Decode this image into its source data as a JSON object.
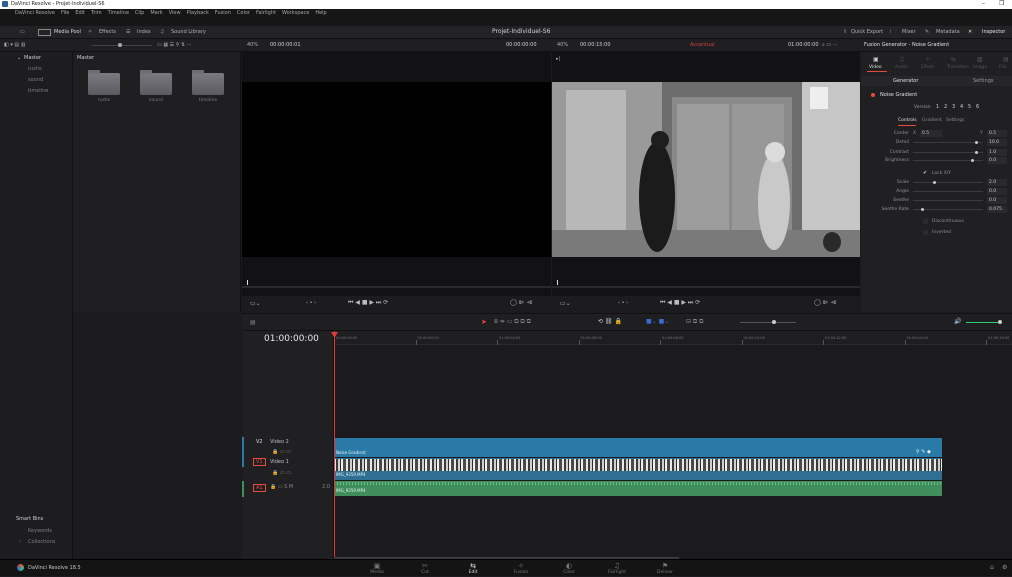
{
  "window": {
    "title": "DaVinci Resolve - Projet-Individuel-S6",
    "minimize": "–",
    "restore": "❐"
  },
  "menu": [
    "DaVinci Resolve",
    "File",
    "Edit",
    "Trim",
    "Timeline",
    "Clip",
    "Mark",
    "View",
    "Playback",
    "Fusion",
    "Color",
    "Fairlight",
    "Workspace",
    "Help"
  ],
  "toolbar": {
    "media_pool": "Media Pool",
    "effects": "Effects",
    "index": "Index",
    "sound_library": "Sound Library",
    "project_title": "Projet-Individuel-S6",
    "quick_export": "Quick Export",
    "mixer": "Mixer",
    "metadata": "Metadata",
    "inspector": "Inspector"
  },
  "viewer_bar": {
    "src_zoom": "40%",
    "src_timecode": "00:00:00:01",
    "src_right_tc": "00:00:00:00",
    "pgm_zoom": "40%",
    "pgm_timecode": "00:00:15:00",
    "pgm_label": "Accentual",
    "pgm_right_tc": "01:00:00:00",
    "inspector_title": "Fusion Generator - Noise Gradient"
  },
  "bins": {
    "master": "Master",
    "items": [
      "rushs",
      "sound",
      "timeline"
    ],
    "smart_bins": "Smart Bins",
    "smart_items": [
      "Keywords",
      "Collections"
    ]
  },
  "pool": {
    "header": "Master",
    "folders": [
      "rushs",
      "sound",
      "timeline"
    ]
  },
  "inspector": {
    "tabs": [
      "Video",
      "Audio",
      "Effect",
      "Transition",
      "Image",
      "File"
    ],
    "subtabs": [
      "Generator",
      "Settings"
    ],
    "effect_name": "Noise Gradient",
    "version_label": "Version",
    "versions": [
      "1",
      "2",
      "3",
      "4",
      "5",
      "6"
    ],
    "inner_tabs": [
      "Controls",
      "Gradient",
      "Settings"
    ],
    "params": [
      {
        "label": "Center",
        "x_label": "X",
        "x": "0.5",
        "y_label": "Y",
        "y": "0.5"
      },
      {
        "label": "Detail",
        "value": "10.0"
      },
      {
        "label": "Contrast",
        "value": "1.0"
      },
      {
        "label": "Brightness",
        "value": "0.0"
      },
      {
        "label": "Lock X/Y"
      },
      {
        "label": "Scale",
        "value": "2.0"
      },
      {
        "label": "Angle",
        "value": "0.0"
      },
      {
        "label": "Seethe",
        "value": "0.0"
      },
      {
        "label": "Seethe Rate",
        "value": "0.075"
      },
      {
        "label": "Discontinuous"
      },
      {
        "label": "Inverted"
      }
    ]
  },
  "timeline": {
    "timecode": "01:00:00:00",
    "ruler": [
      "01:00:00:00",
      "01:00:02:00",
      "01:00:04:00",
      "01:00:06:00",
      "01:00:08:00",
      "01:00:10:00",
      "01:00:12:00",
      "01:00:14:00",
      "01:00:16:00"
    ],
    "tracks": {
      "v2": {
        "id": "V2",
        "name": "Video 2"
      },
      "v1": {
        "id": "V1",
        "name": "Video 1"
      },
      "a1": {
        "id": "A1",
        "ch": "2.0"
      }
    },
    "clips": {
      "noise": "Noise Gradient",
      "video": "IMG_9359.MP4",
      "audio": "IMG_9359.MP4"
    }
  },
  "footer": {
    "app": "DaVinci Resolve 18.5",
    "pages": [
      "Media",
      "Cut",
      "Edit",
      "Fusion",
      "Color",
      "Fairlight",
      "Deliver"
    ]
  },
  "colors": {
    "accent": "#e64b3c",
    "clip_blue": "#2a7aa8",
    "clip_green": "#3f8e5b",
    "playhead": "#e0393b"
  }
}
